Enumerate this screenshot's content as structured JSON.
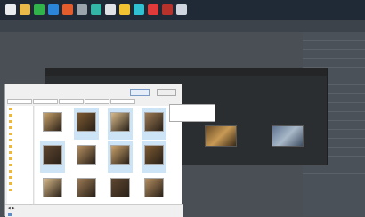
{
  "taskbar": {
    "icons": [
      {
        "name": "windows-icon",
        "color": "#e9ecef"
      },
      {
        "name": "folder-icon",
        "color": "#e9b949"
      },
      {
        "name": "app-green-icon",
        "color": "#2fb34a"
      },
      {
        "name": "app-blue-icon",
        "color": "#2b86d9"
      },
      {
        "name": "app-orange-icon",
        "color": "#e35d2c"
      },
      {
        "name": "app-gray-icon",
        "color": "#9aa4ad"
      },
      {
        "name": "app-teal-icon",
        "color": "#33b6a8"
      },
      {
        "name": "app-white-icon",
        "color": "#dfe3e7"
      },
      {
        "name": "app-yellow-icon",
        "color": "#f1c232"
      },
      {
        "name": "app-cyan-icon",
        "color": "#30c2d3"
      },
      {
        "name": "app-red-icon",
        "color": "#e03a3a"
      },
      {
        "name": "app-darkred-icon",
        "color": "#b8322c"
      },
      {
        "name": "app-last-icon",
        "color": "#cfd6dd"
      }
    ],
    "clock_time": "",
    "clock_date": ""
  },
  "right_panel": {
    "items": [
      "",
      "",
      "",
      "",
      "",
      "",
      "",
      "",
      "",
      "",
      "",
      "",
      "",
      "",
      "",
      ""
    ]
  },
  "gallery": {
    "header": "",
    "columns": [
      {
        "title": ""
      },
      {
        "title": ""
      },
      {
        "title": ""
      }
    ],
    "accent_thumbs": [
      "#8a6a3a",
      "#b88a55",
      "#6b7f95"
    ]
  },
  "dialog": {
    "address_crumbs": [
      "",
      "",
      "",
      "",
      ""
    ],
    "primary_button": "",
    "secondary_button": "",
    "nav_items": [
      "",
      "",
      "",
      "",
      "",
      "",
      "",
      "",
      "",
      "",
      "",
      "",
      "",
      ""
    ],
    "files": [
      {
        "label": "",
        "selected": false
      },
      {
        "label": "",
        "selected": true
      },
      {
        "label": "",
        "selected": true
      },
      {
        "label": "",
        "selected": true
      },
      {
        "label": "",
        "selected": true
      },
      {
        "label": "",
        "selected": false
      },
      {
        "label": "",
        "selected": true
      },
      {
        "label": "",
        "selected": true
      },
      {
        "label": "",
        "selected": false
      },
      {
        "label": "",
        "selected": false
      },
      {
        "label": "",
        "selected": false
      },
      {
        "label": "",
        "selected": false
      }
    ],
    "footer_path": "",
    "footer_filter": ""
  },
  "tooltip": {
    "lines": [
      "",
      "",
      "",
      ""
    ]
  },
  "bottom_bar": {
    "items": [
      "",
      "",
      ""
    ]
  }
}
